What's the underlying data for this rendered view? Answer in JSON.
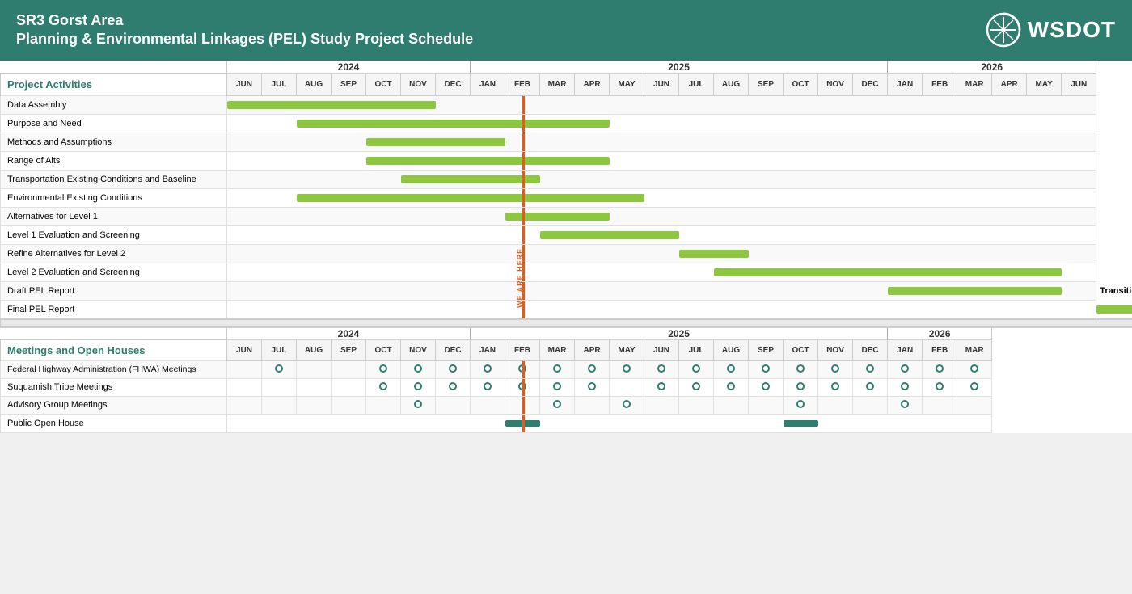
{
  "header": {
    "line1": "SR3 Gorst Area",
    "line2": "Planning & Environmental Linkages (PEL) Study Project Schedule",
    "wsdot": "WSDOT"
  },
  "years": {
    "y2024": "2024",
    "y2025": "2025",
    "y2026": "2026"
  },
  "months_2024": [
    "JUN",
    "JUL",
    "AUG",
    "SEP",
    "OCT",
    "NOV",
    "DEC"
  ],
  "months_2025": [
    "JAN",
    "FEB",
    "MAR",
    "APR",
    "MAY",
    "JUN",
    "JUL",
    "AUG",
    "SEP",
    "OCT",
    "NOV",
    "DEC"
  ],
  "months_2026_main": [
    "JAN",
    "FEB",
    "MAR",
    "APR",
    "MAY",
    "JUN"
  ],
  "months_2026_meet": [
    "JAN",
    "FEB",
    "MAR"
  ],
  "section1_label": "Project Activities",
  "section2_label": "Meetings and Open Houses",
  "activities": [
    "Data Assembly",
    "Purpose and Need",
    "Methods and Assumptions",
    "Range of Alts",
    "Transportation Existing Conditions and Baseline",
    "Environmental Existing Conditions",
    "Alternatives for Level 1",
    "Level 1 Evaluation and Screening",
    "Refine Alternatives for Level 2",
    "Level 2 Evaluation and Screening",
    "Draft PEL Report",
    "Final PEL Report"
  ],
  "meetings": [
    "Federal Highway Administration (FHWA) Meetings",
    "Suquamish Tribe Meetings",
    "Advisory Group Meetings",
    "Public Open House"
  ],
  "today_label": "WE ARE HERE",
  "nepa_label": "Transition to NEPA"
}
